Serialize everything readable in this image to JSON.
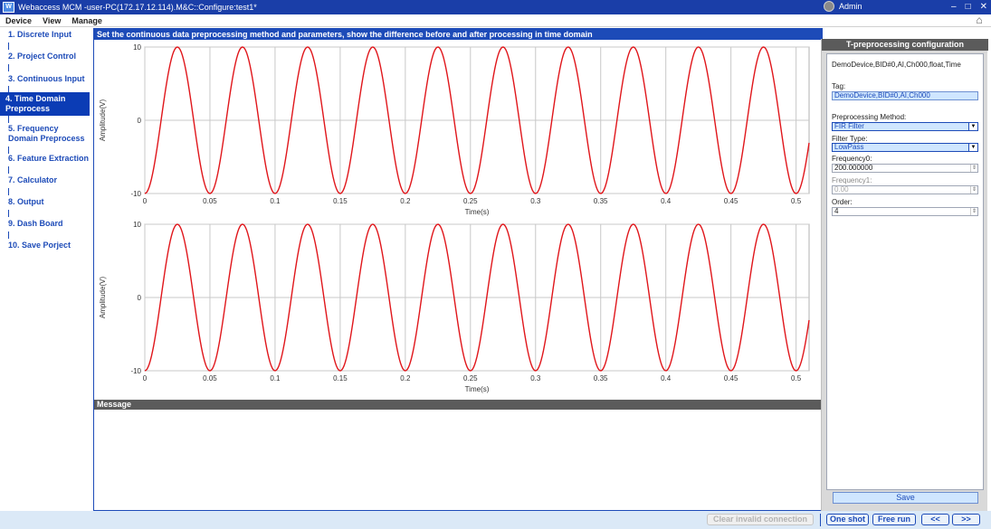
{
  "window": {
    "title": "Webaccess MCM -user-PC(172.17.12.114).M&C::Configure:test1*",
    "user": "Admin",
    "minimize": "–",
    "maximize": "□",
    "close": "✕"
  },
  "menu": {
    "items": [
      "Device",
      "View",
      "Manage"
    ]
  },
  "nav": {
    "items": [
      {
        "label": "1. Discrete Input"
      },
      {
        "label": "2. Project Control"
      },
      {
        "label": "3. Continuous Input"
      },
      {
        "label": "4. Time Domain Preprocess"
      },
      {
        "label": "5. Frequency Domain Preprocess"
      },
      {
        "label": "6. Feature Extraction"
      },
      {
        "label": "7. Calculator"
      },
      {
        "label": "8. Output"
      },
      {
        "label": "9. Dash Board"
      },
      {
        "label": "10. Save Porject"
      }
    ],
    "active_index": 3
  },
  "main": {
    "header": "Set the continuous data preprocessing method and parameters, show the difference before and after processing in time domain",
    "message_header": "Message"
  },
  "chart_data": [
    {
      "type": "line",
      "title": "",
      "xlabel": "Time(s)",
      "ylabel": "Amplitude(V)",
      "xlim": [
        0,
        0.51
      ],
      "ylim": [
        -10,
        10
      ],
      "xticks": [
        "0",
        "0.05",
        "0.1",
        "0.15",
        "0.2",
        "0.25",
        "0.3",
        "0.35",
        "0.4",
        "0.45",
        "0.5"
      ],
      "yticks": [
        "10",
        "0",
        "-10"
      ],
      "grid": true,
      "series": [
        {
          "amplitude": 10,
          "frequency_hz": 20,
          "color": "#e0161b"
        }
      ]
    },
    {
      "type": "line",
      "title": "",
      "xlabel": "Time(s)",
      "ylabel": "Amplitude(V)",
      "xlim": [
        0,
        0.51
      ],
      "ylim": [
        -10,
        10
      ],
      "xticks": [
        "0",
        "0.05",
        "0.1",
        "0.15",
        "0.2",
        "0.25",
        "0.3",
        "0.35",
        "0.4",
        "0.45",
        "0.5"
      ],
      "yticks": [
        "10",
        "0",
        "-10"
      ],
      "grid": true,
      "series": [
        {
          "amplitude": 10,
          "frequency_hz": 20,
          "color": "#e0161b"
        }
      ]
    }
  ],
  "config": {
    "header": "T-preprocessing configuration",
    "channel": "DemoDevice,BID#0,AI,Ch000,float,Time",
    "tag_label": "Tag:",
    "tag_value": "DemoDevice,BID#0,AI,Ch000",
    "method_label": "Preprocessing Method:",
    "method_value": "FIR Filter",
    "filter_type_label": "Filter Type:",
    "filter_type_value": "LowPass",
    "freq0_label": "Frequency0:",
    "freq0_value": "200.000000",
    "freq1_label": "Frequency1:",
    "freq1_value": "0.00",
    "order_label": "Order:",
    "order_value": "4",
    "save_label": "Save"
  },
  "bottom": {
    "clear_label": "Clear invalid connection",
    "one_shot_label": "One shot",
    "free_run_label": "Free run",
    "prev_label": "<<",
    "next_label": ">>"
  }
}
